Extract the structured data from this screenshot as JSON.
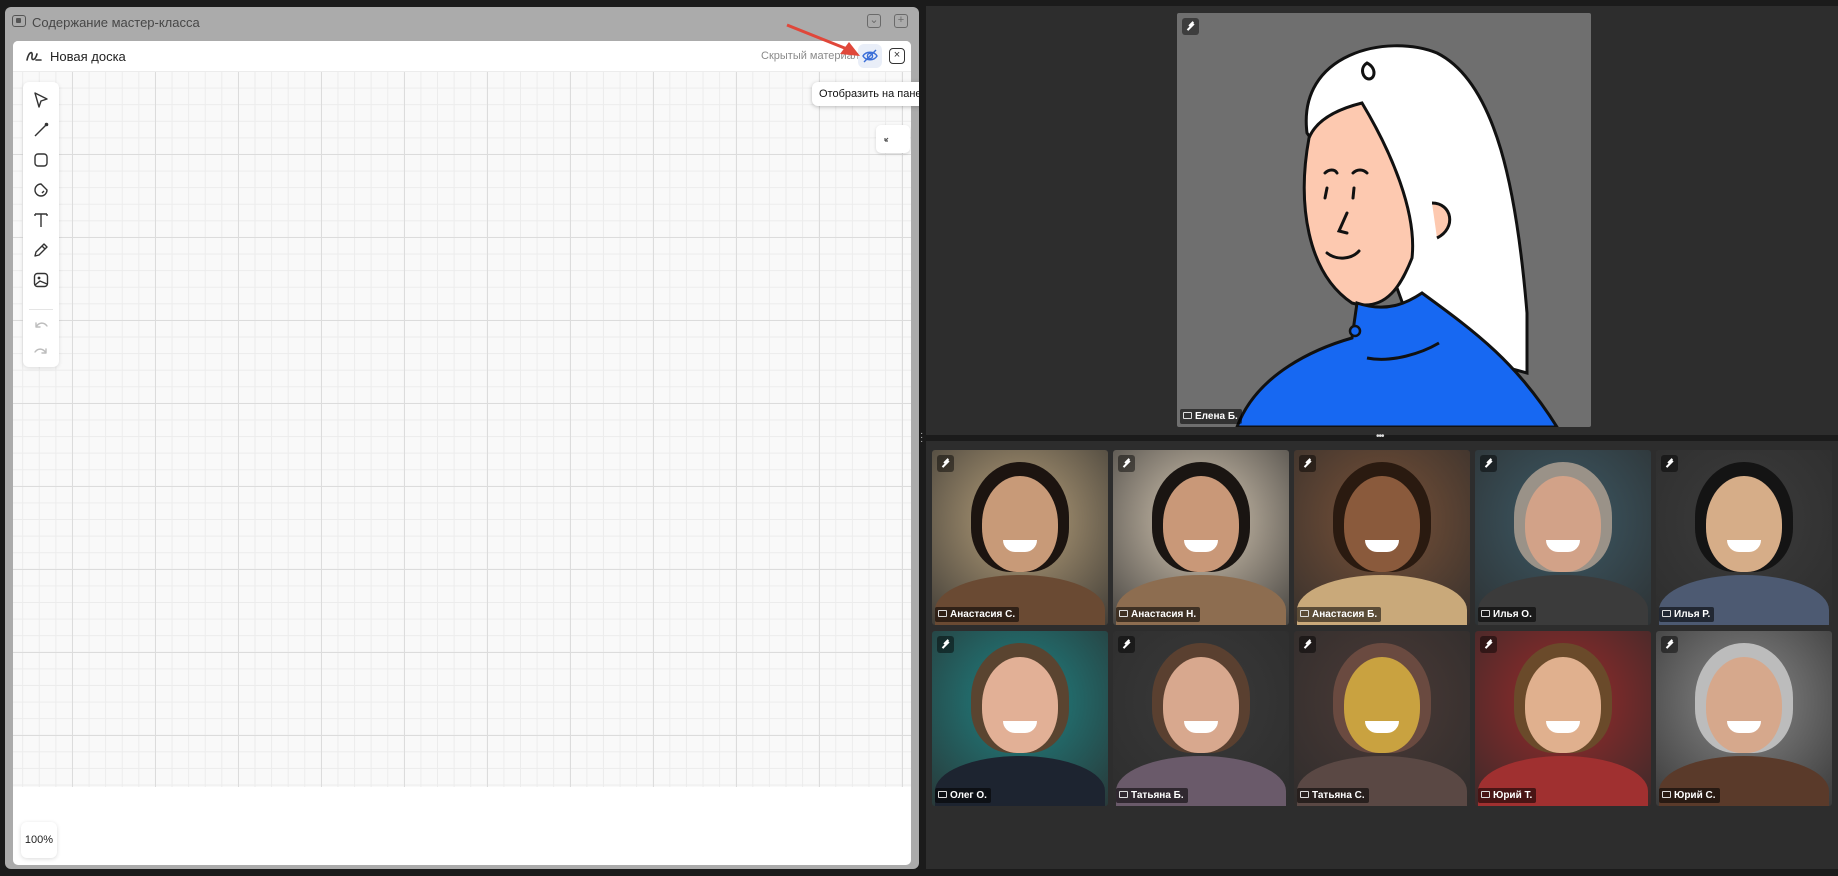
{
  "panel": {
    "title": "Содержание мастер-класса"
  },
  "board": {
    "title": "Новая доска",
    "hidden_label": "Скрытый материал",
    "tooltip": "Отобразить на панели",
    "zoom": "100%"
  },
  "toolbar": {
    "tools": [
      "select-tool",
      "line-tool",
      "shape-tool",
      "sticker-tool",
      "text-tool",
      "pen-tool",
      "image-tool",
      "undo-tool",
      "redo-tool"
    ]
  },
  "speaker": {
    "name": "Елена Б."
  },
  "participants": [
    {
      "name": "Анастасия С.",
      "bg": "#b9a27c",
      "skin": "#c89a78",
      "hair": "#1c1410",
      "cloth": "#6a4a33"
    },
    {
      "name": "Анастасия Н.",
      "bg": "#d9cbb6",
      "skin": "#c99878",
      "hair": "#1a1512",
      "cloth": "#8d6d50"
    },
    {
      "name": "Анастасия Б.",
      "bg": "#7a5238",
      "skin": "#8a5a3c",
      "hair": "#2a1a10",
      "cloth": "#c9a97a"
    },
    {
      "name": "Илья О.",
      "bg": "#3d5a66",
      "skin": "#d2a288",
      "hair": "#9a9288",
      "cloth": "#3b3b3b"
    },
    {
      "name": "Илья Р.",
      "bg": "#3c3c3c",
      "skin": "#d6ad88",
      "hair": "#141414",
      "cloth": "#4d5a72"
    },
    {
      "name": "Олег О.",
      "bg": "#1f8484",
      "skin": "#e2b096",
      "hair": "#5a4430",
      "cloth": "#1d2430"
    },
    {
      "name": "Татьяна Б.",
      "bg": "#3a3a3a",
      "skin": "#d8a88e",
      "hair": "#5a4030",
      "cloth": "#6a5a6a"
    },
    {
      "name": "Татьяна С.",
      "bg": "#4b3a36",
      "skin": "#c9a240",
      "hair": "#6a4a40",
      "cloth": "#5a4844"
    },
    {
      "name": "Юрий Т.",
      "bg": "#9a2a2a",
      "skin": "#e0b08e",
      "hair": "#6a4a2a",
      "cloth": "#a03030"
    },
    {
      "name": "Юрий С.",
      "bg": "#8a8a8a",
      "skin": "#d6a88c",
      "hair": "#bcbcbc",
      "cloth": "#5a3a2a"
    }
  ],
  "colors": {
    "accent_arrow": "#e0473a",
    "speaker_shirt": "#1768f2",
    "speaker_skin": "#fdc9b0",
    "speaker_bg": "#6f6f6f"
  }
}
